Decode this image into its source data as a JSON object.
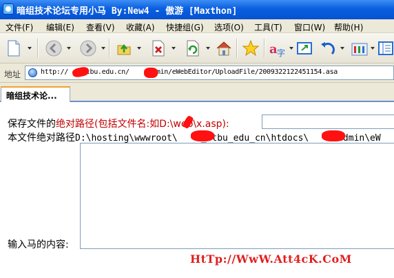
{
  "window": {
    "title": "暗组技术论坛专用小马 By:New4 - 傲游 [Maxthon]"
  },
  "menu": {
    "items": [
      "文件(F)",
      "编辑(E)",
      "查看(V)",
      "收藏(A)",
      "快捷组(G)",
      "选项(O)",
      "工具(T)",
      "窗口(W)",
      "帮助(H)"
    ]
  },
  "toolbar": {
    "icons": [
      "new-page-icon",
      "back-icon",
      "forward-icon",
      "up-icon",
      "stop-icon",
      "refresh-icon",
      "home-icon",
      "favorites-star-icon",
      "translate-icon",
      "fullscreen-icon",
      "undo-icon",
      "tools-icon",
      "panel-icon"
    ]
  },
  "address": {
    "label": "地址",
    "url_part1": "http://",
    "url_part2": "ctbu.edu.cn/",
    "url_part3": "/admin/eWebEditor/UploadFile/2009322122451154.asa"
  },
  "tab": {
    "label": "暗组技术论..."
  },
  "form": {
    "save_label_black": "保存文件的",
    "save_label_red": "绝对路径(包括文件名:如D:\\web\\x.asp):",
    "path_label": "本文件绝对路径",
    "path_value_part1": "D:\\hosting\\wwwroot\\",
    "path_value_part2": "_ctbu_edu_cn\\htdocs\\",
    "path_value_part3": "\\admin\\eW",
    "content_label": "输入马的内容:"
  },
  "watermark": {
    "text": "HtTp://WwW.Att4cK.CoM"
  },
  "colors": {
    "titlebar": "#0a5fe0",
    "accent_red": "#c00000",
    "watermark_red": "#e02020"
  }
}
